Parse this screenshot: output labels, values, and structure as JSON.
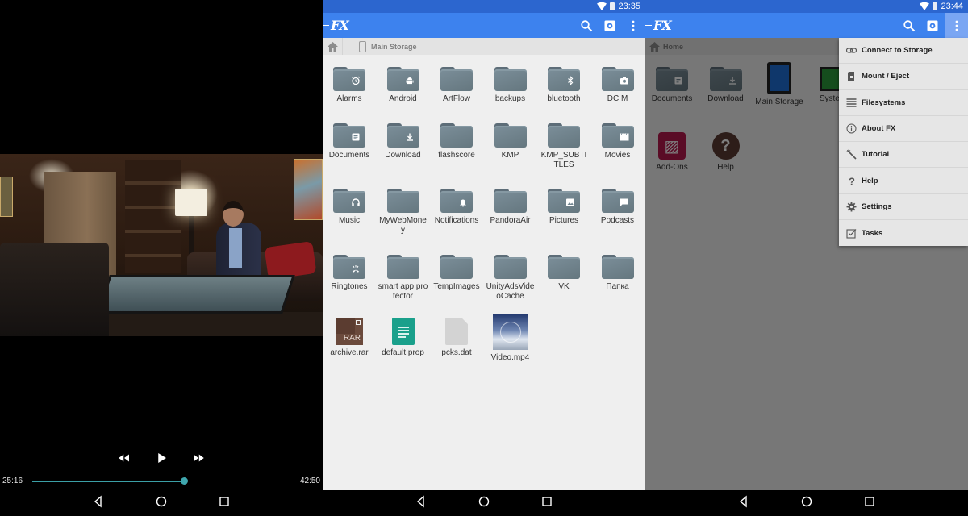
{
  "colors": {
    "status_bar": "#2c66cf",
    "app_bar": "#3d82ee",
    "seek_accent": "#3b9fa6",
    "folder": "#718590"
  },
  "video_player": {
    "current_time": "25:16",
    "total_time": "42:50",
    "progress_fraction": 0.59,
    "controls": [
      "rewind",
      "play",
      "fast-forward"
    ]
  },
  "storage_panel": {
    "status_time": "23:35",
    "app_logo": "FX",
    "breadcrumb": {
      "home_icon": "home-icon",
      "device_icon": "phone-icon",
      "label": "Main Storage"
    },
    "items": [
      {
        "name": "Alarms",
        "type": "folder",
        "badge": "alarm"
      },
      {
        "name": "Android",
        "type": "folder",
        "badge": "android"
      },
      {
        "name": "ArtFlow",
        "type": "folder",
        "badge": ""
      },
      {
        "name": "backups",
        "type": "folder",
        "badge": ""
      },
      {
        "name": "bluetooth",
        "type": "folder",
        "badge": "bluetooth"
      },
      {
        "name": "DCIM",
        "type": "folder",
        "badge": "camera"
      },
      {
        "name": "Documents",
        "type": "folder",
        "badge": "document"
      },
      {
        "name": "Download",
        "type": "folder",
        "badge": "download"
      },
      {
        "name": "flashscore",
        "type": "folder",
        "badge": ""
      },
      {
        "name": "KMP",
        "type": "folder",
        "badge": ""
      },
      {
        "name": "KMP_SUBTITLES",
        "type": "folder",
        "badge": ""
      },
      {
        "name": "Movies",
        "type": "folder",
        "badge": "clapper"
      },
      {
        "name": "Music",
        "type": "folder",
        "badge": "headphones"
      },
      {
        "name": "MyWebMoney",
        "type": "folder",
        "badge": ""
      },
      {
        "name": "Notifications",
        "type": "folder",
        "badge": "bell"
      },
      {
        "name": "PandoraAir",
        "type": "folder",
        "badge": ""
      },
      {
        "name": "Pictures",
        "type": "folder",
        "badge": "image"
      },
      {
        "name": "Podcasts",
        "type": "folder",
        "badge": "chat"
      },
      {
        "name": "Ringtones",
        "type": "folder",
        "badge": "ringtone"
      },
      {
        "name": "smart app protector",
        "type": "folder",
        "badge": ""
      },
      {
        "name": "TempImages",
        "type": "folder",
        "badge": ""
      },
      {
        "name": "UnityAdsVideoCache",
        "type": "folder",
        "badge": ""
      },
      {
        "name": "VK",
        "type": "folder",
        "badge": ""
      },
      {
        "name": "Папка",
        "type": "folder",
        "badge": ""
      },
      {
        "name": "archive.rar",
        "type": "rar",
        "badge": ""
      },
      {
        "name": "default.prop",
        "type": "doc",
        "badge": ""
      },
      {
        "name": "pcks.dat",
        "type": "blank",
        "badge": ""
      },
      {
        "name": "Video.mp4",
        "type": "video",
        "badge": ""
      }
    ]
  },
  "home_panel": {
    "status_time": "23:44",
    "app_logo": "FX",
    "breadcrumb": {
      "label": "Home"
    },
    "items": [
      {
        "name": "Documents",
        "type": "folder-doc"
      },
      {
        "name": "Download",
        "type": "folder-download"
      },
      {
        "name": "Main Storage",
        "type": "device-main"
      },
      {
        "name": "System",
        "type": "device-system"
      },
      {
        "name": "Add-Ons",
        "type": "addons"
      },
      {
        "name": "Help",
        "type": "help"
      }
    ],
    "overflow_menu": [
      {
        "label": "Connect to Storage",
        "icon": "link-icon"
      },
      {
        "label": "Mount / Eject",
        "icon": "sd-card-icon"
      },
      {
        "label": "Filesystems",
        "icon": "list-icon"
      },
      {
        "label": "About FX",
        "icon": "info-icon"
      },
      {
        "label": "Tutorial",
        "icon": "wand-icon"
      },
      {
        "label": "Help",
        "icon": "question-icon"
      },
      {
        "label": "Settings",
        "icon": "gear-icon"
      },
      {
        "label": "Tasks",
        "icon": "checkbox-icon"
      }
    ]
  }
}
